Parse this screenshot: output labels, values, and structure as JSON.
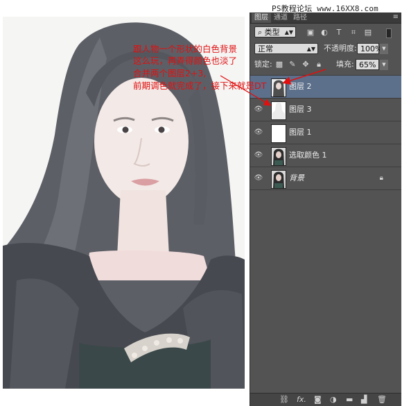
{
  "watermark": "PS教程论坛 www.16XX8.com",
  "panel": {
    "tabs": [
      "图层",
      "通道",
      "路径"
    ],
    "active_tab": "图层",
    "filter_label": "类型",
    "blend_mode": "正常",
    "opacity_label": "不透明度:",
    "opacity_value": "100%",
    "lock_label": "锁定:",
    "fill_label": "填充:",
    "fill_value": "65%",
    "layers": [
      {
        "name": "图层 2",
        "selected": true,
        "visible": false,
        "thumb": "portrait"
      },
      {
        "name": "图层 3",
        "selected": false,
        "visible": true,
        "thumb": "silhouette"
      },
      {
        "name": "图层 1",
        "selected": false,
        "visible": true,
        "thumb": "white"
      },
      {
        "name": "选取颜色 1",
        "selected": false,
        "visible": true,
        "thumb": "portrait"
      },
      {
        "name": "背景",
        "selected": false,
        "visible": true,
        "thumb": "portrait",
        "locked": true
      }
    ]
  },
  "annotation": {
    "line1": "跟人物一个形状的白色背景",
    "line2": "这么玩，再弄得颜色也淡了",
    "line3": "合并两个图层2+3,",
    "line4": "前期调色就完成了，接下来就是DT"
  },
  "colors": {
    "panel_bg": "#535353",
    "selected_row": "#5c6f8b",
    "annotation_red": "#e01010"
  }
}
